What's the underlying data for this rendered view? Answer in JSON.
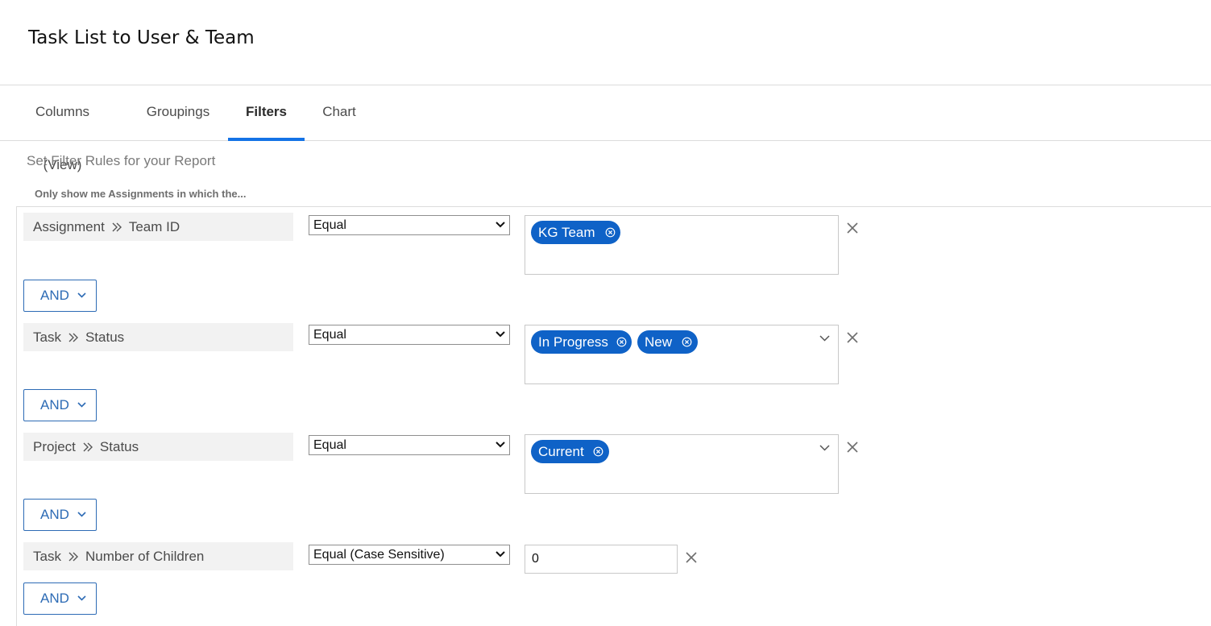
{
  "header": {
    "title": "Task List to User & Team"
  },
  "tabs": [
    {
      "label": "Columns (View)",
      "active": false
    },
    {
      "label": "Groupings",
      "active": false
    },
    {
      "label": "Filters",
      "active": true
    },
    {
      "label": "Chart",
      "active": false
    }
  ],
  "subtitle": "Set Filter Rules for your Report",
  "intro": "Only show me Assignments in which the...",
  "colors": {
    "accent": "#1473e6",
    "chip": "#0f62c7",
    "and_button": "#2d6bb5"
  },
  "filters": [
    {
      "object": "Assignment",
      "field": "Team ID",
      "operator": "Equal",
      "values": [
        "KG Team"
      ],
      "has_dropdown": false
    },
    {
      "object": "Task",
      "field": "Status",
      "operator": "Equal",
      "values": [
        "In Progress",
        "New"
      ],
      "has_dropdown": true
    },
    {
      "object": "Project",
      "field": "Status",
      "operator": "Equal",
      "values": [
        "Current"
      ],
      "has_dropdown": true
    },
    {
      "object": "Task",
      "field": "Number of Children",
      "operator": "Equal (Case Sensitive)",
      "text_value": "0"
    }
  ],
  "and_label": "AND",
  "icons": {
    "separator": "double-chevron-right-icon",
    "remove": "close-icon",
    "chip_remove": "circle-x-icon",
    "dropdown": "chevron-down-icon"
  }
}
